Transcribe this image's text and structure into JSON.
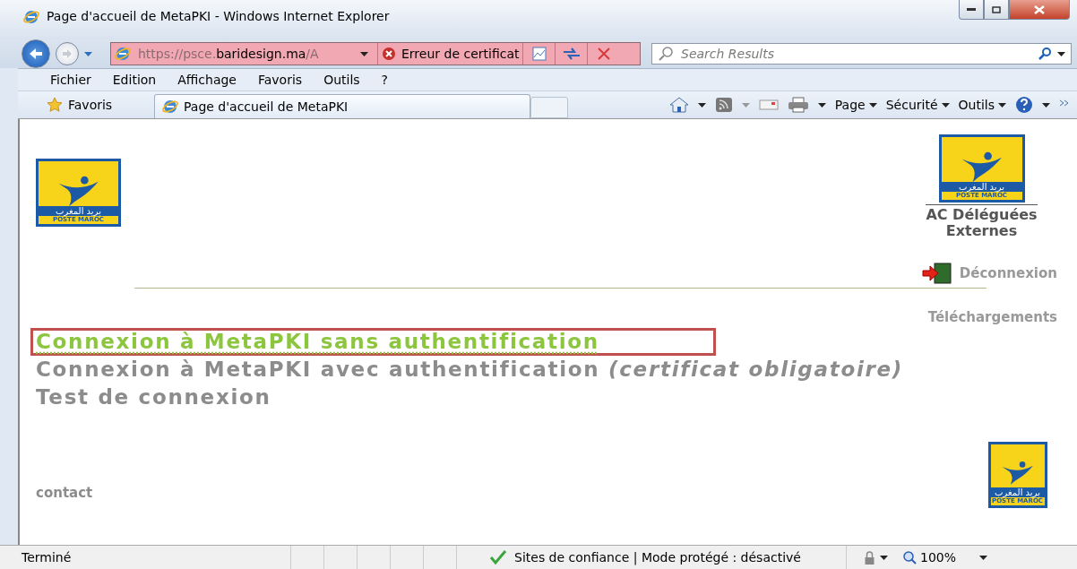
{
  "window": {
    "title": "Page d'accueil de MetaPKI - Windows Internet Explorer"
  },
  "address_bar": {
    "url_faded_start": "https://psce.",
    "url_domain": "baridesign.ma",
    "url_faded_end": "/A",
    "certificate_error": "Erreur de certificat"
  },
  "search": {
    "placeholder": "Search Results"
  },
  "menu": [
    "Fichier",
    "Edition",
    "Affichage",
    "Favoris",
    "Outils",
    "?"
  ],
  "favorites_bar": {
    "favorites": "Favoris",
    "tab_title": "Page d'accueil de MetaPKI"
  },
  "command_bar": [
    "Page",
    "Sécurité",
    "Outils"
  ],
  "page": {
    "logos": [
      {
        "arabic": "بريد المغرب",
        "latin": "POSTE MAROC"
      },
      {
        "arabic": "بريد المغرب",
        "latin": "POSTE MAROC"
      },
      {
        "arabic": "بريد المغرب",
        "latin": "POSTE MAROC"
      }
    ],
    "site_title": [
      "AC Déléguées",
      "Externes"
    ],
    "logout": "Déconnexion",
    "downloads": "Téléchargements",
    "links": [
      {
        "text": "Connexion à MetaPKI sans authentification",
        "active": true,
        "highlighted": true
      },
      {
        "text": "Connexion à MetaPKI avec authentification *(certificat obligatoire)*",
        "active": false,
        "highlighted": false
      },
      {
        "text": "Test de connexion",
        "active": false,
        "highlighted": false
      }
    ],
    "contact": "contact"
  },
  "status_bar": {
    "status": "Terminé",
    "zone": "Sites de confiance | Mode protégé : désactivé",
    "zoom": "100%"
  }
}
